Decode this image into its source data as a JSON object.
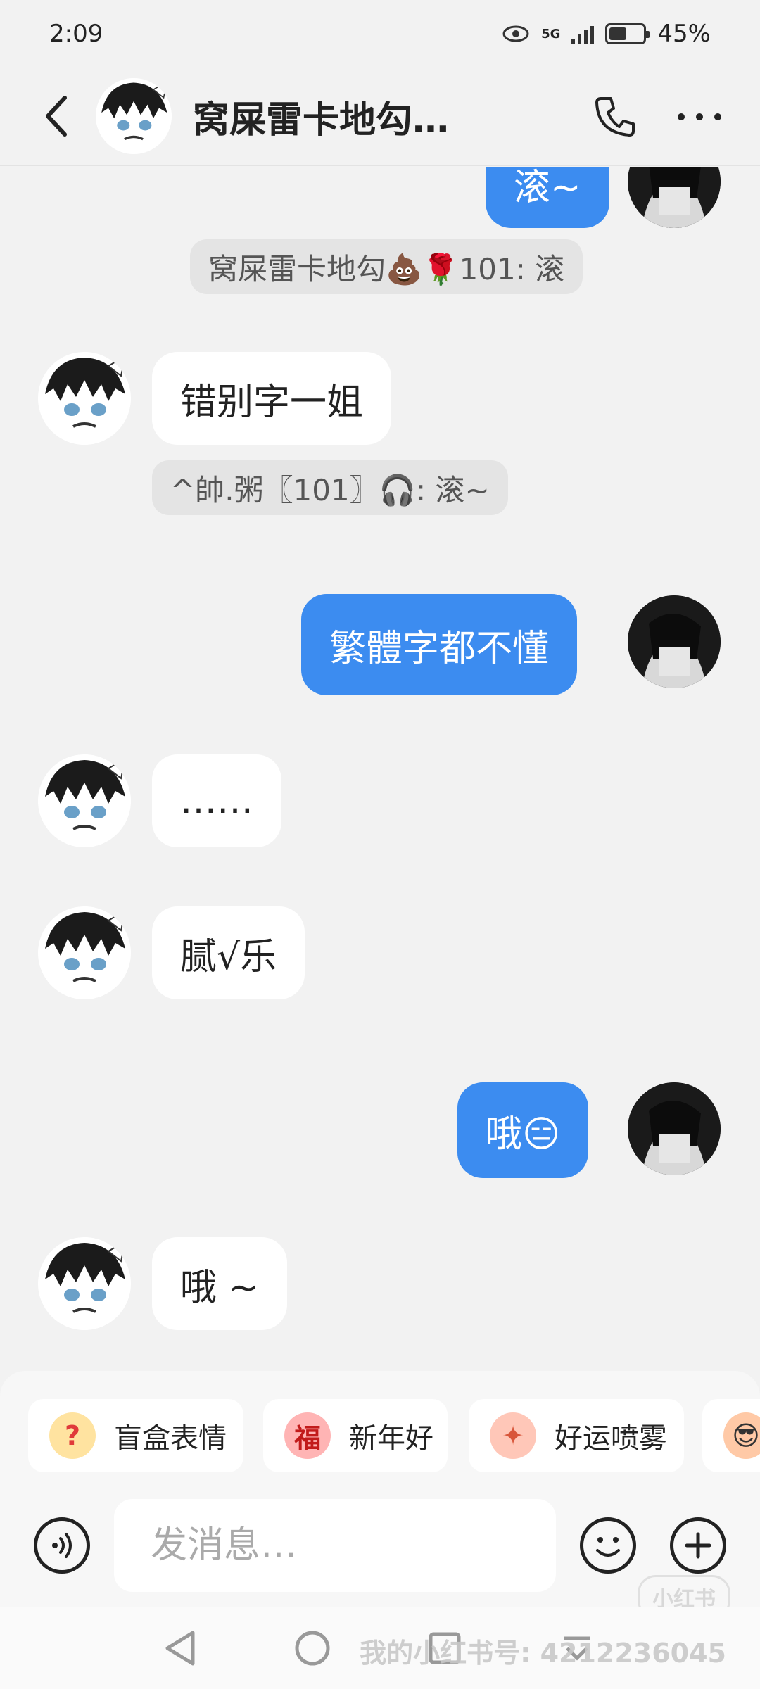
{
  "status": {
    "time": "2:09",
    "network": "5G",
    "battery": "45%",
    "battery_level": 0.45
  },
  "header": {
    "title": "窝屎雷卡地勾…"
  },
  "messages": {
    "m1": "滚~",
    "sys1": "窝屎雷卡地勾💩🌹101: 滚",
    "m2": "错别字一姐",
    "sys2": "^帥.粥〖101〗🎧: 滚~",
    "m3": "繁體字都不懂",
    "m4": "……",
    "m5": "腻√乐",
    "m6": "哦😑",
    "m7": "哦 ~"
  },
  "quick_replies": [
    {
      "label": "盲盒表情",
      "icon": "question-bag-icon"
    },
    {
      "label": "新年好",
      "icon": "new-year-pig-icon"
    },
    {
      "label": "好运喷雾",
      "icon": "lucky-spray-icon"
    }
  ],
  "input": {
    "placeholder": "发消息…"
  },
  "watermark": {
    "logo": "小红书",
    "text": "我的小红书号: 4212236045"
  }
}
